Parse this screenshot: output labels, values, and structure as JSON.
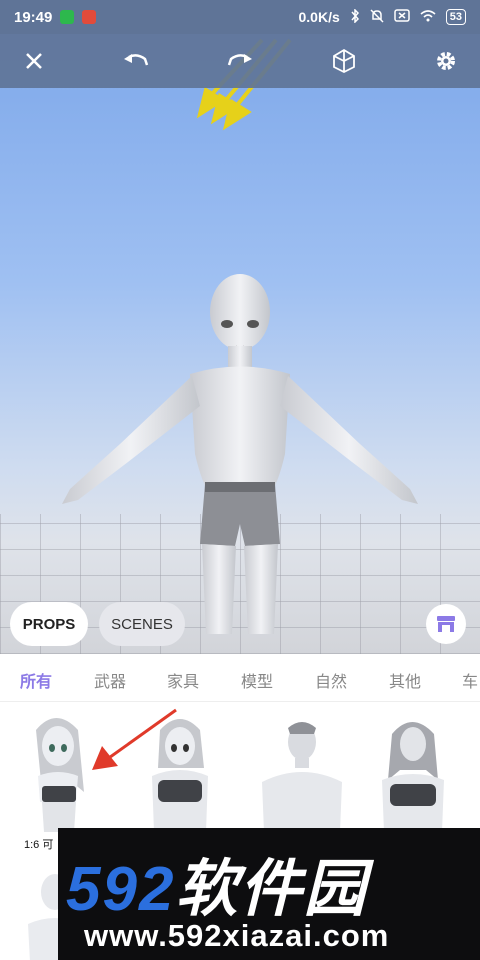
{
  "status_bar": {
    "time": "19:49",
    "net_speed": "0.0K/s",
    "battery": "53"
  },
  "toolbar": {
    "close": "close-icon",
    "undo": "undo-icon",
    "redo": "redo-icon",
    "view3d": "cube-icon",
    "settings": "gear-icon"
  },
  "mode_buttons": {
    "props": "PROPS",
    "scenes": "SCENES"
  },
  "tabs": [
    "所有",
    "武器",
    "家具",
    "模型",
    "自然",
    "其他",
    "车"
  ],
  "items": [
    {
      "label": "1:6 可"
    },
    {
      "label": ""
    },
    {
      "label": ""
    },
    {
      "label": ""
    }
  ],
  "watermark": {
    "num": "592",
    "cn": "软件园",
    "url": "www.592xiazai.com"
  },
  "colors": {
    "accent": "#8c7ae6",
    "toolbar": "#5f7497",
    "watermark_blue": "#2b6fde"
  }
}
